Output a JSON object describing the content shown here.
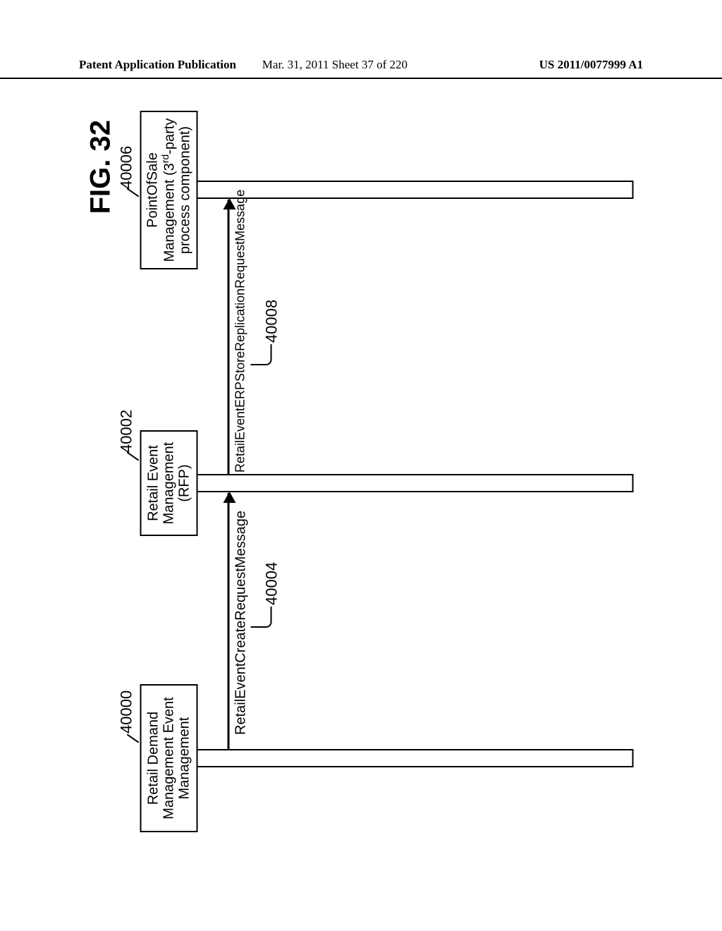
{
  "header": {
    "left": "Patent Application Publication",
    "center": "Mar. 31, 2011  Sheet 37 of 220",
    "right": "US 2011/0077999 A1"
  },
  "figure": {
    "title": "FIG. 32"
  },
  "components": {
    "c1": {
      "label_line1": "Retail Demand",
      "label_line2": "Management Event",
      "label_line3": "Management",
      "ref": "40000"
    },
    "c2": {
      "label_line1": "Retail Event",
      "label_line2": "Management",
      "label_line3": "(RFP)",
      "ref": "40002"
    },
    "c3": {
      "label_line1": "PointOfSale",
      "label_line2_pre": "Management (3",
      "label_line2_sup": "rd",
      "label_line2_post": "-party",
      "label_line3": "process component)",
      "ref": "40006"
    }
  },
  "messages": {
    "m1": {
      "label": "RetailEventCreateRequestMessage",
      "ref": "40004"
    },
    "m2": {
      "label": "RetailEventERPStoreReplicationRequestMessage",
      "ref": "40008"
    }
  }
}
